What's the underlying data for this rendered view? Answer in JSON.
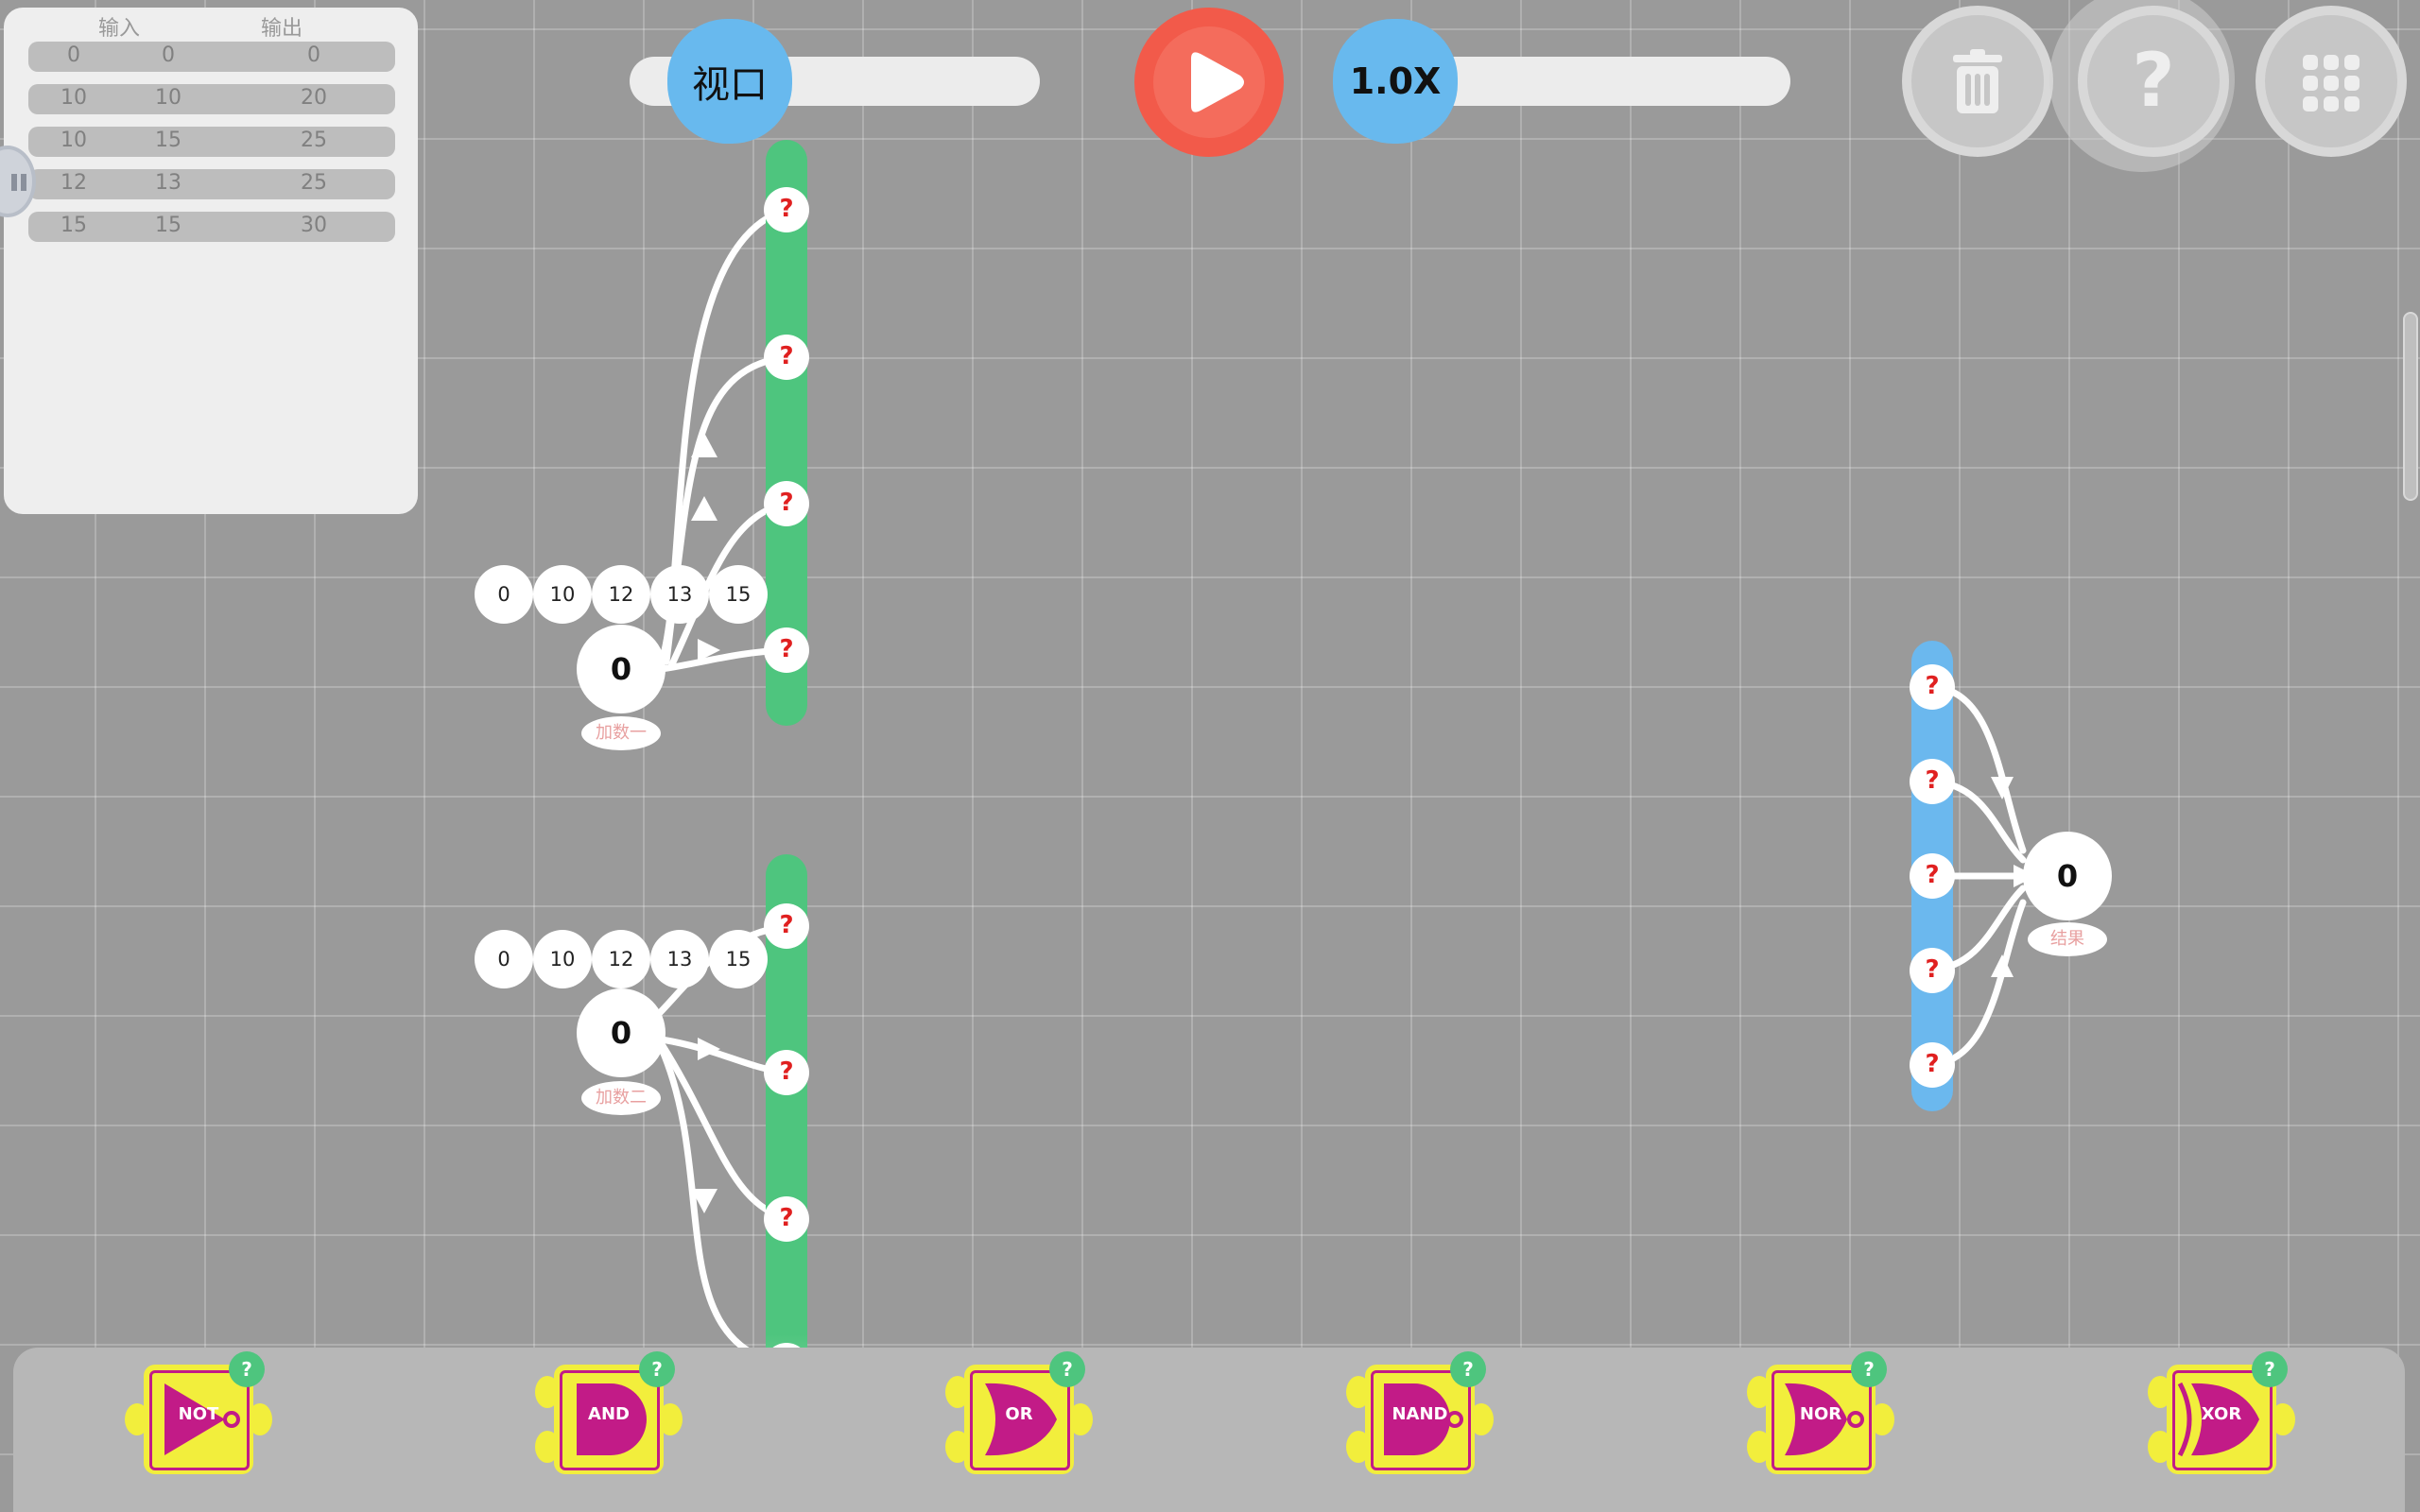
{
  "truth_table": {
    "headers": {
      "input": "输入",
      "output": "输出"
    },
    "rows": [
      {
        "a": "0",
        "b": "0",
        "out": "0"
      },
      {
        "a": "10",
        "b": "10",
        "out": "20"
      },
      {
        "a": "10",
        "b": "15",
        "out": "25"
      },
      {
        "a": "12",
        "b": "13",
        "out": "25"
      },
      {
        "a": "15",
        "b": "15",
        "out": "30"
      }
    ]
  },
  "toolbar": {
    "viewport_label": "视口",
    "speed_label": "1.0X",
    "play_icon": "play-icon",
    "trash_icon": "trash-icon",
    "help_icon": "help-icon",
    "help_text": "?",
    "menu_icon": "grid-menu-icon"
  },
  "adder1": {
    "values": [
      "0",
      "10",
      "12",
      "13",
      "15"
    ],
    "value": "0",
    "label": "加数一",
    "ports": [
      "?",
      "?",
      "?",
      "?"
    ]
  },
  "adder2": {
    "values": [
      "0",
      "10",
      "12",
      "13",
      "15"
    ],
    "value": "0",
    "label": "加数二",
    "ports": [
      "?",
      "?",
      "?",
      "?"
    ]
  },
  "result": {
    "value": "0",
    "label": "结果",
    "ports": [
      "?",
      "?",
      "?",
      "?",
      "?"
    ]
  },
  "gates": [
    {
      "label": "NOT",
      "help": "?"
    },
    {
      "label": "AND",
      "help": "?"
    },
    {
      "label": "OR",
      "help": "?"
    },
    {
      "label": "NAND",
      "help": "?"
    },
    {
      "label": "NOR",
      "help": "?"
    },
    {
      "label": "XOR",
      "help": "?"
    }
  ],
  "colors": {
    "background": "#9a9a9a",
    "green_bus": "#4ec57e",
    "blue_bus": "#6bb8ee",
    "play_red": "#f25a4a",
    "gate_yellow": "#f2ee3c",
    "gate_magenta": "#c21b87"
  }
}
